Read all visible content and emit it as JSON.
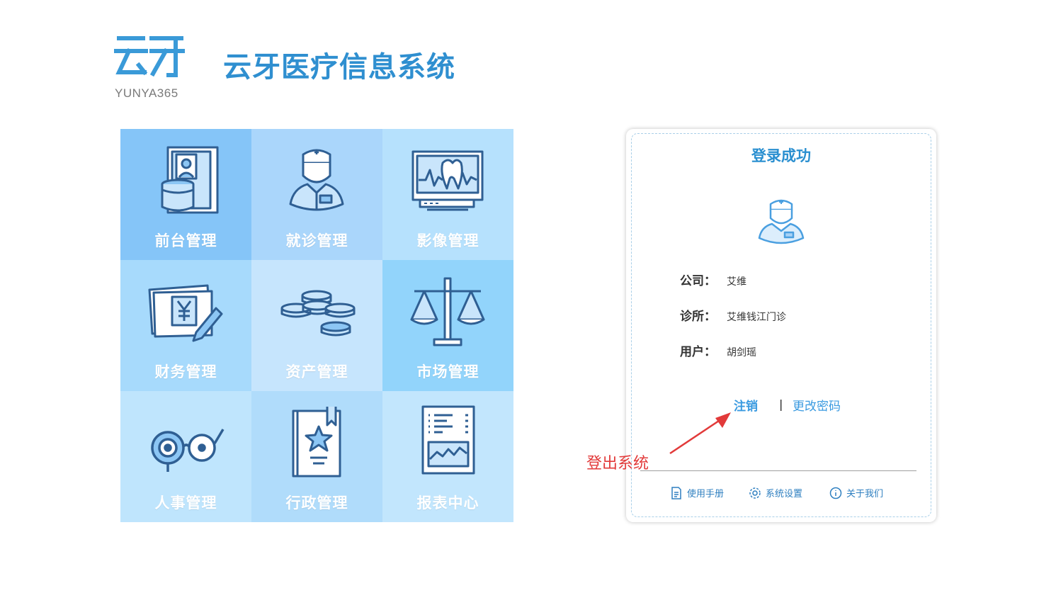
{
  "logo": {
    "mark": "云牙",
    "subtitle": "YUNYA365"
  },
  "brand": {
    "title": "云牙医疗信息系统"
  },
  "tiles": [
    {
      "label": "前台管理",
      "icon": "front-desk-icon",
      "color": "#85c5f8"
    },
    {
      "label": "就诊管理",
      "icon": "doctor-icon",
      "color": "#aad6fb"
    },
    {
      "label": "影像管理",
      "icon": "tooth-monitor-icon",
      "color": "#b6e1fd"
    },
    {
      "label": "财务管理",
      "icon": "yen-bill-icon",
      "color": "#a7dafc"
    },
    {
      "label": "资产管理",
      "icon": "coins-icon",
      "color": "#c6e5fd"
    },
    {
      "label": "市场管理",
      "icon": "balance-scale-icon",
      "color": "#92d4fb"
    },
    {
      "label": "人事管理",
      "icon": "glasses-icon",
      "color": "#bfe5fd"
    },
    {
      "label": "行政管理",
      "icon": "star-book-icon",
      "color": "#b0dcfb"
    },
    {
      "label": "报表中心",
      "icon": "report-icon",
      "color": "#c2e6fd"
    }
  ],
  "panel": {
    "title": "登录成功",
    "avatar_icon": "doctor-avatar-icon",
    "company_label": "公司：",
    "company_value": "艾维",
    "clinic_label": "诊所：",
    "clinic_value": "艾维钱江门诊",
    "user_label": "用户：",
    "user_value": "胡剑瑶",
    "logout": "注销",
    "separator": "|",
    "change_password": "更改密码",
    "footer": {
      "manual": "使用手册",
      "settings": "系统设置",
      "about": "关于我们"
    }
  },
  "annotation": {
    "text": "登出系统",
    "color": "#e23a3a"
  },
  "colors": {
    "accent": "#2f8fd0",
    "icon_stroke": "#2f5f93"
  }
}
